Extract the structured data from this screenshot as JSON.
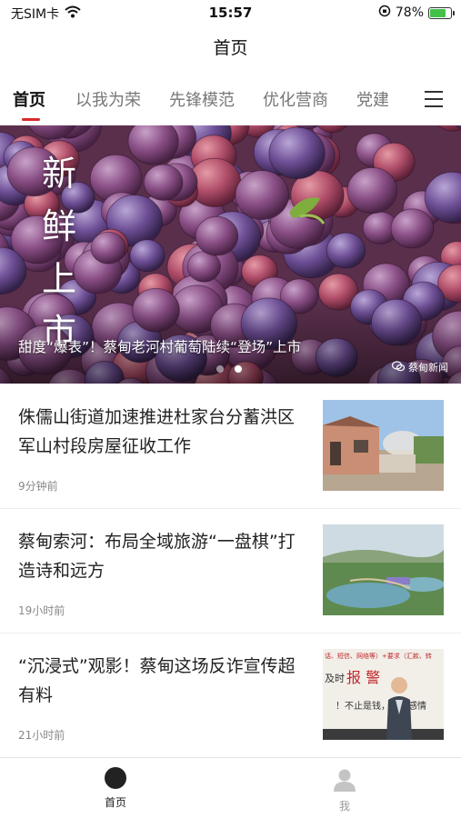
{
  "status_bar": {
    "carrier": "无SIM卡",
    "time": "15:57",
    "battery_percent": "78%",
    "battery_level": 0.78,
    "icons": [
      "wifi-icon",
      "orientation-lock-icon",
      "battery-charging-icon"
    ]
  },
  "nav": {
    "title": "首页"
  },
  "tabs": {
    "items": [
      {
        "label": "首页",
        "active": true
      },
      {
        "label": "以我为荣"
      },
      {
        "label": "先锋模范"
      },
      {
        "label": "优化营商"
      },
      {
        "label": "党建"
      }
    ],
    "menu_icon": "menu-icon",
    "accent_color": "#d8272c"
  },
  "banner": {
    "tagline": "新鲜上市",
    "caption": "甜度“爆表”！蔡甸老河村葡萄陆续“登场”上市",
    "watermark": "蔡甸新闻",
    "slide_count": 2,
    "active_slide": 2
  },
  "news": [
    {
      "title": "侏儒山街道加速推进杜家台分蓄洪区军山村段房屋征收工作",
      "time": "9分钟前"
    },
    {
      "title": "蔡甸索河：布局全域旅游“一盘棋”打造诗和远方",
      "time": "19小时前"
    },
    {
      "title": "“沉浸式”观影！蔡甸这场反诈宣传超有料",
      "time": "21小时前",
      "thumb_text": {
        "line1": "话、短信、网络等）+要求（汇款、转",
        "line2_prefix": "及时",
        "line2_alarm": "报 警",
        "line3": "！不止是钱，还有感情"
      }
    }
  ],
  "tabbar": {
    "items": [
      {
        "label": "首页",
        "icon": "home-icon",
        "active": true
      },
      {
        "label": "我",
        "icon": "person-icon"
      }
    ]
  }
}
